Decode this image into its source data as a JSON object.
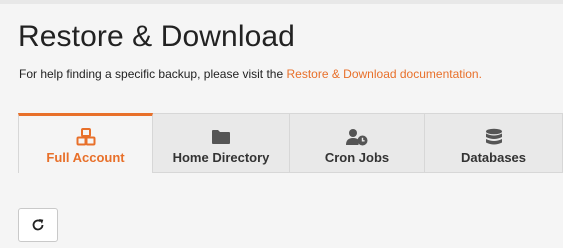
{
  "page": {
    "title": "Restore & Download",
    "help_prefix": "For help finding a specific backup, please visit the ",
    "help_link": "Restore & Download documentation."
  },
  "tabs": [
    {
      "label": "Full Account",
      "icon": "boxes-icon",
      "active": true
    },
    {
      "label": "Home Directory",
      "icon": "folder-icon",
      "active": false
    },
    {
      "label": "Cron Jobs",
      "icon": "user-clock-icon",
      "active": false
    },
    {
      "label": "Databases",
      "icon": "database-icon",
      "active": false
    }
  ],
  "refresh_button": {
    "icon": "refresh-icon"
  },
  "colors": {
    "accent": "#e8702a",
    "text": "#222222",
    "tab_bg": "#e9e9e9",
    "icon_gray": "#555555"
  }
}
